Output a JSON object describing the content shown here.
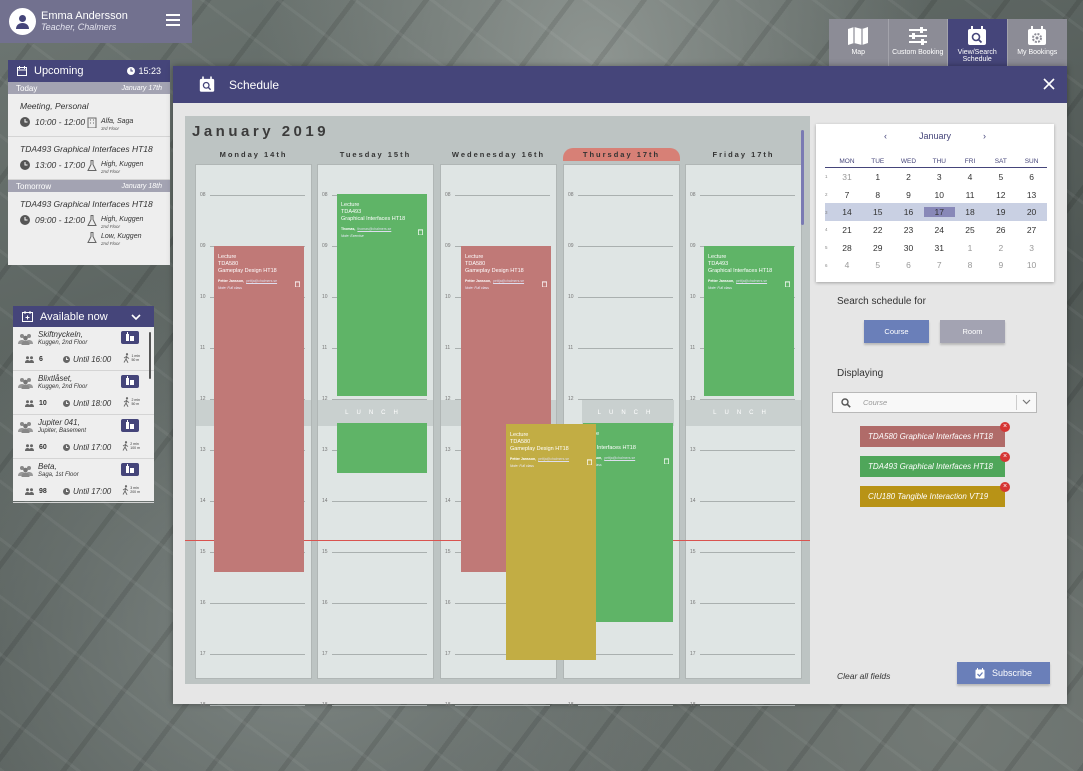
{
  "user": {
    "name": "Emma Andersson",
    "role": "Teacher, Chalmers"
  },
  "nav": [
    {
      "label": "Map",
      "icon": "map-icon"
    },
    {
      "label": "Custom Booking",
      "icon": "sliders-icon"
    },
    {
      "label": "View/Search Schedule",
      "icon": "calendar-search-icon",
      "active": true
    },
    {
      "label": "My Bookings",
      "icon": "calendar-gear-icon"
    }
  ],
  "upcoming": {
    "title": "Upcoming",
    "time": "15:23",
    "today_label": "Today",
    "today_date": "January 17th",
    "tomorrow_label": "Tomorrow",
    "tomorrow_date": "January 18th",
    "items": [
      {
        "title": "Meeting, Personal",
        "time": "10:00 - 12:00",
        "room": "Alfa, Saga",
        "floor": "3rd Floor"
      },
      {
        "title": "TDA493 Graphical Interfaces HT18",
        "time": "13:00 - 17:00",
        "room": "High, Kuggen",
        "floor": "2nd Floor"
      },
      {
        "title": "TDA493 Graphical Interfaces HT18",
        "time": "09:00 - 12:00",
        "room": "High, Kuggen",
        "floor": "2nd Floor",
        "room2": "Low, Kuggen",
        "floor2": "2nd Floor"
      }
    ]
  },
  "available": {
    "title": "Available now",
    "rooms": [
      {
        "name": "Skiftnyckeln,",
        "place": "Kuggen, 2nd Floor",
        "cap": "6",
        "until": "Until 16:00",
        "walk1": "1 min",
        "walk2": "50 m"
      },
      {
        "name": "Blixtlåset,",
        "place": "Kuggen, 2nd Floor",
        "cap": "10",
        "until": "Until 18:00",
        "walk1": "2 min",
        "walk2": "50 m"
      },
      {
        "name": "Jupiter 041,",
        "place": "Jupiter, Basement",
        "cap": "60",
        "until": "Until 17:00",
        "walk1": "2 min",
        "walk2": "100 m"
      },
      {
        "name": "Beta,",
        "place": "Saga, 1st Floor",
        "cap": "98",
        "until": "Until 17:00",
        "walk1": "3 min",
        "walk2": "200 m"
      }
    ]
  },
  "schedule": {
    "title": "Schedule",
    "month": "January 2019",
    "days": [
      "Monday 14th",
      "Tuesday 15th",
      "Wedenesday 16th",
      "Thursday 17th",
      "Friday 17th"
    ],
    "hours": [
      "08",
      "09",
      "10",
      "11",
      "12",
      "13",
      "14",
      "15",
      "16",
      "17",
      "18"
    ],
    "lunch": "LUNCH",
    "now_label": "15:23",
    "events": {
      "mon": {
        "type": "Lecture",
        "code": "TDA580",
        "name": "Gameplay Design HT18",
        "teacher": "Petter Jansson,",
        "email": "pettja@chalmers.se",
        "note": "Note: Full class"
      },
      "tue": {
        "type": "Lecture",
        "code": "TDA493",
        "name": "Graphical Interfaces HT18",
        "teacher": "Thomas,",
        "email": "thomas@chalmers.se",
        "note": "Note: Exercise"
      },
      "wed": {
        "type": "Lecture",
        "code": "TDA580",
        "name": "Gameplay Design HT18",
        "teacher": "Petter Jansson,",
        "email": "pettja@chalmers.se",
        "note": "Note: Full class"
      },
      "thu_green": {
        "type": "cture",
        "code": "493",
        "name": "ical Interfaces HT18",
        "teacher": "Jansson,",
        "email": "pettja@chalmers.se",
        "note": "Full class"
      },
      "thu_yellow": {
        "type": "Lecture",
        "code": "TDA580",
        "name": "Gameplay Design HT18",
        "teacher": "Petter Jansson,",
        "email": "pettja@chalmers.se",
        "note": "Note: Full class"
      },
      "fri": {
        "type": "Lecture",
        "code": "TDA493",
        "name": "Graphical Interfaces HT18",
        "teacher": "Petter Jansson,",
        "email": "pettja@chalmers.se",
        "note": "Note: Full class"
      }
    }
  },
  "calendar": {
    "month": "January",
    "prev": "‹",
    "next": "›",
    "weekdays": [
      "MON",
      "TUE",
      "WED",
      "THU",
      "FRI",
      "SAT",
      "SUN"
    ],
    "weeks": [
      {
        "wk": "1",
        "days": [
          "31",
          "1",
          "2",
          "3",
          "4",
          "5",
          "6"
        ]
      },
      {
        "wk": "2",
        "days": [
          "7",
          "8",
          "9",
          "10",
          "11",
          "12",
          "13"
        ]
      },
      {
        "wk": "3",
        "days": [
          "14",
          "15",
          "16",
          "17",
          "18",
          "19",
          "20"
        ]
      },
      {
        "wk": "4",
        "days": [
          "21",
          "22",
          "23",
          "24",
          "25",
          "26",
          "27"
        ]
      },
      {
        "wk": "5",
        "days": [
          "28",
          "29",
          "30",
          "31",
          "1",
          "2",
          "3"
        ]
      },
      {
        "wk": "6",
        "days": [
          "4",
          "5",
          "6",
          "7",
          "8",
          "9",
          "10"
        ]
      }
    ]
  },
  "search": {
    "label": "Search schedule for",
    "course_btn": "Course",
    "room_btn": "Room",
    "displaying": "Displaying",
    "placeholder": "Course",
    "chips": [
      {
        "label": "TDA580 Graphical Interfaces HT18",
        "color": "#b06b69"
      },
      {
        "label": "TDA493 Graphical Interfaces HT18",
        "color": "#4fa65a"
      },
      {
        "label": "CIU180 Tangible Interaction VT19",
        "color": "#b89316"
      }
    ],
    "remove": "×",
    "clear": "Clear all fields",
    "subscribe": "Subscribe"
  },
  "colors": {
    "brand": "#45457a",
    "red": "#c07977",
    "green": "#5fb467",
    "yellow": "#c2ad44",
    "accent": "#6a7fb9"
  }
}
